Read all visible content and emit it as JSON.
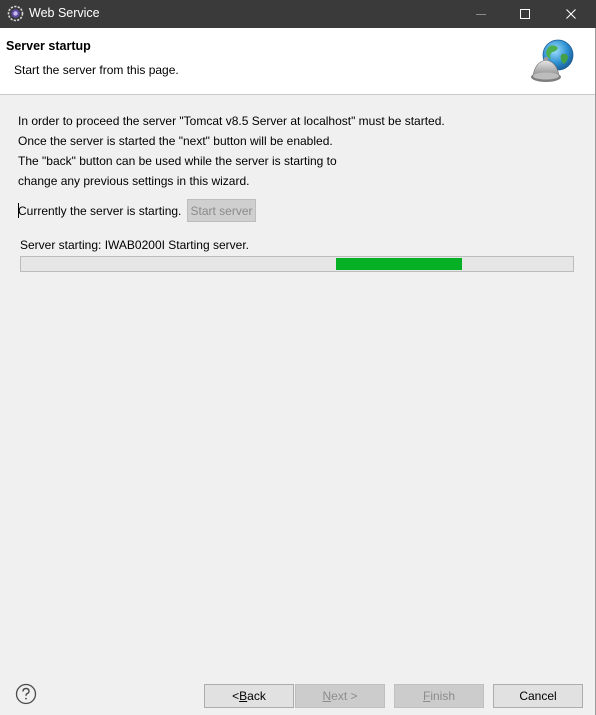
{
  "window": {
    "title": "Web Service",
    "controls": {
      "minimize": "minimize",
      "maximize": "maximize",
      "close": "close"
    }
  },
  "header": {
    "title": "Server startup",
    "description": "Start the server from this page."
  },
  "content": {
    "lines": [
      "In order to proceed the server \"Tomcat v8.5 Server at localhost\" must be started.",
      "Once the server is started the \"next\" button will be enabled.",
      "The \"back\" button can be used while the server is starting to",
      "change any previous settings in this wizard."
    ],
    "server_status": "Currently the server is starting.",
    "start_button": "Start server",
    "progress_message": "Server starting: IWAB0200I Starting server.",
    "progress": {
      "indeterminate": true,
      "segment_start": 0.571,
      "segment_end": 0.8,
      "color": "#06b025"
    }
  },
  "footer": {
    "back_pre": "< ",
    "back_mnemonic": "B",
    "back_post": "ack",
    "next_pre": "",
    "next_mnemonic": "N",
    "next_post": "ext >",
    "finish_pre": "",
    "finish_mnemonic": "F",
    "finish_post": "inish",
    "cancel": "Cancel"
  },
  "icons": {
    "app": "eclipse-icon",
    "help": "help-icon",
    "wizard": "globe-server-icon"
  },
  "colors": {
    "titlebar": "#3a3a3a",
    "banner": "#ffffff",
    "body": "#f0f0f0",
    "progress": "#06b025"
  }
}
